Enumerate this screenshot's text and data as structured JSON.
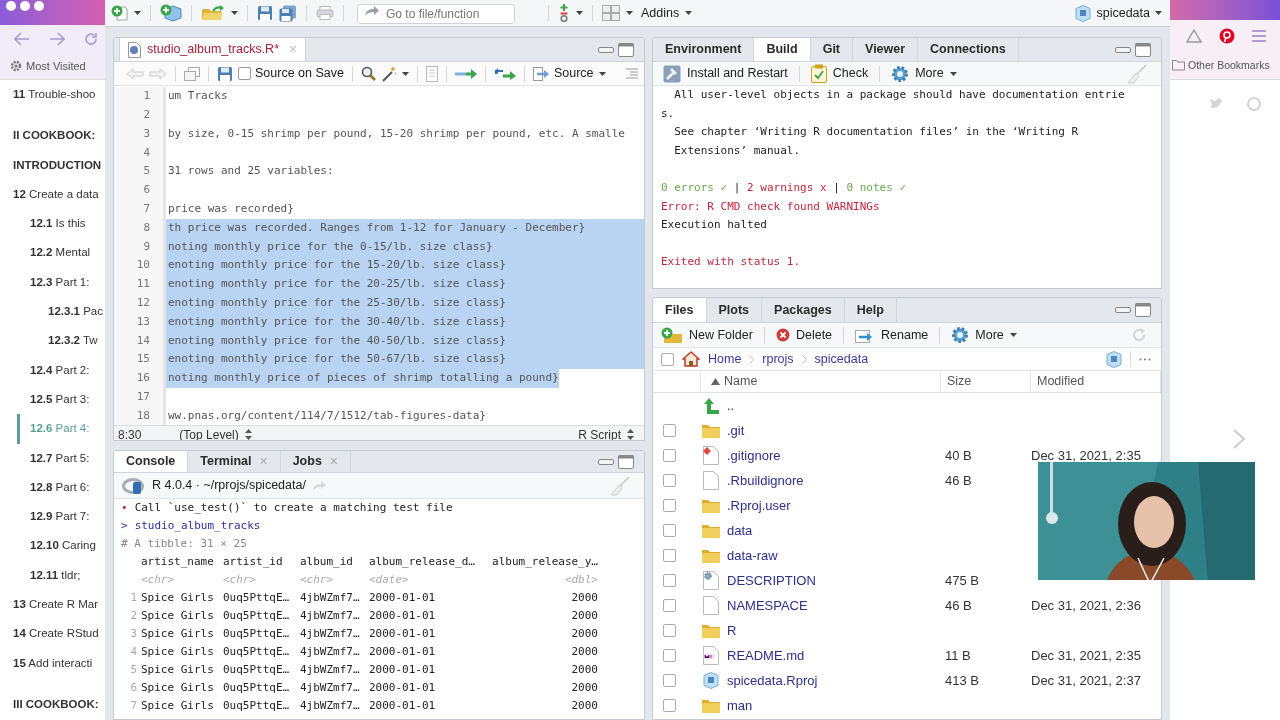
{
  "browser": {
    "bookmark": "Most Visited",
    "other_bookmarks": "Other Bookmarks"
  },
  "toc": [
    {
      "kind": "chapter",
      "text": "**11** Trouble-shoo",
      "selected": false
    },
    {
      "kind": "part",
      "text": "II COOKBOOK:",
      "selected": false
    },
    {
      "kind": "part",
      "text": "INTRODUCTION",
      "selected": false
    },
    {
      "kind": "chapter",
      "text": "**12** Create a data",
      "selected": false,
      "children": [
        {
          "kind": "chapter",
          "text": "**12.1** Is this",
          "selected": false
        },
        {
          "kind": "chapter",
          "text": "**12.2** Mental",
          "selected": false
        },
        {
          "kind": "chapter",
          "text": "**12.3** Part 1:",
          "selected": false,
          "children": [
            {
              "kind": "chapter",
              "text": "**12.3.1** Pac",
              "selected": false
            },
            {
              "kind": "chapter",
              "text": "**12.3.2** Tw",
              "selected": false
            }
          ]
        },
        {
          "kind": "chapter",
          "text": "**12.4** Part 2:",
          "selected": false
        },
        {
          "kind": "chapter",
          "text": "**12.5** Part 3:",
          "selected": false
        },
        {
          "kind": "chapter",
          "text": "**12.6** Part 4:",
          "selected": true
        },
        {
          "kind": "chapter",
          "text": "**12.7** Part 5:",
          "selected": false
        },
        {
          "kind": "chapter",
          "text": "**12.8** Part 6:",
          "selected": false
        },
        {
          "kind": "chapter",
          "text": "**12.9** Part 7:",
          "selected": false
        },
        {
          "kind": "chapter",
          "text": "**12.10** Caring",
          "selected": false
        },
        {
          "kind": "chapter",
          "text": "**12.11** tldr;",
          "selected": false
        }
      ]
    },
    {
      "kind": "chapter",
      "text": "**13** Create R Mar",
      "selected": false
    },
    {
      "kind": "chapter",
      "text": "**14** Create RStud",
      "selected": false
    },
    {
      "kind": "chapter",
      "text": "**15** Add interacti",
      "selected": false
    },
    {
      "kind": "part",
      "text": "III COOKBOOK:",
      "selected": false
    }
  ],
  "toolbar": {
    "goto_placeholder": "Go to file/function",
    "addins": "Addins",
    "project": "spicedata"
  },
  "editor": {
    "tab": {
      "name": "studio_album_tracks.R*",
      "modified": true,
      "close": "×"
    },
    "source_on_save": {
      "label": "Source on Save",
      "checked": false
    },
    "source": "Source",
    "lines": [
      {
        "number": "1",
        "text": "um Tracks",
        "selected": false
      },
      {
        "number": "2",
        "selected": false
      },
      {
        "number": "3",
        "text": "by size, 0-15 shrimp per pound, 15-20 shrimp per pound, etc. A smalle",
        "selected": false
      },
      {
        "number": "4",
        "selected": false
      },
      {
        "number": "5",
        "text": "31 rows and 25 variables:",
        "selected": false
      },
      {
        "number": "6",
        "selected": false
      },
      {
        "number": "7",
        "text": "price was recorded}",
        "selected": false
      },
      {
        "number": "8",
        "text": "th price was recorded. Ranges from 1-12 for January - December}",
        "selected": true
      },
      {
        "number": "9",
        "text": "noting monthly price for the 0-15/lb. size class}",
        "selected": true
      },
      {
        "number": "10",
        "text": "enoting monthly price for the 15-20/lb. size class}",
        "selected": true
      },
      {
        "number": "11",
        "text": "enoting monthly price for the 20-25/lb. size class}",
        "selected": true
      },
      {
        "number": "12",
        "text": "enoting monthly price for the 25-30/lb. size class}",
        "selected": true
      },
      {
        "number": "13",
        "text": "enoting monthly price for the 30-40/lb. size class}",
        "selected": true
      },
      {
        "number": "14",
        "text": "enoting monthly price for the 40-50/lb. size class}",
        "selected": true
      },
      {
        "number": "15",
        "text": "enoting monthly price for the 50-67/lb. size class}",
        "selected": true
      },
      {
        "number": "16",
        "text": "noting monthly price of pieces of shrimp totalling a pound}",
        "selected": true
      },
      {
        "number": "17",
        "selected": false
      },
      {
        "number": "18",
        "text": "ww.pnas.org/content/114/7/1512/tab-figures-data}",
        "selected": false
      }
    ],
    "position": "8:30",
    "scope": "(Top Level)",
    "file_type": "R Script"
  },
  "console": {
    "tabs": [
      {
        "label": "Console",
        "selected": true
      },
      {
        "label": "Terminal",
        "selected": false,
        "close": "×"
      },
      {
        "label": "Jobs",
        "selected": false,
        "close": "×"
      }
    ],
    "header": "R 4.0.4 · ~/rprojs/spicedata/",
    "lines": [
      {
        "kind": "message",
        "bullet": "•",
        "text": "Call `use_test()` to create a matching test file"
      },
      {
        "kind": "input",
        "prompt": ">",
        "text": "studio_album_tracks"
      },
      {
        "kind": "comment",
        "text": "# A tibble: 31 × 25"
      }
    ],
    "table": {
      "columns": [
        {
          "name": "artist_name",
          "type": "<chr>"
        },
        {
          "name": "artist_id",
          "type": "<chr>"
        },
        {
          "name": "album_id",
          "type": "<chr>"
        },
        {
          "name": "album_release_d…",
          "type": "<date>"
        },
        {
          "name": "album_release_y…",
          "type": "<dbl>"
        }
      ],
      "rows": [
        {
          "index": "1",
          "cells": [
            "Spice Girls",
            "0uq5PttqE…",
            "4jbWZmf7…",
            "2000-01-01",
            "2000"
          ]
        },
        {
          "index": "2",
          "cells": [
            "Spice Girls",
            "0uq5PttqE…",
            "4jbWZmf7…",
            "2000-01-01",
            "2000"
          ]
        },
        {
          "index": "3",
          "cells": [
            "Spice Girls",
            "0uq5PttqE…",
            "4jbWZmf7…",
            "2000-01-01",
            "2000"
          ]
        },
        {
          "index": "4",
          "cells": [
            "Spice Girls",
            "0uq5PttqE…",
            "4jbWZmf7…",
            "2000-01-01",
            "2000"
          ]
        },
        {
          "index": "5",
          "cells": [
            "Spice Girls",
            "0uq5PttqE…",
            "4jbWZmf7…",
            "2000-01-01",
            "2000"
          ]
        },
        {
          "index": "6",
          "cells": [
            "Spice Girls",
            "0uq5PttqE…",
            "4jbWZmf7…",
            "2000-01-01",
            "2000"
          ]
        },
        {
          "index": "7",
          "cells": [
            "Spice Girls",
            "0uq5PttqE…",
            "4jbWZmf7…",
            "2000-01-01",
            "2000"
          ]
        }
      ]
    }
  },
  "build": {
    "tabs": [
      {
        "label": "Environment",
        "selected": false
      },
      {
        "label": "Build",
        "selected": true
      },
      {
        "label": "Git",
        "selected": false
      },
      {
        "label": "Viewer",
        "selected": false
      },
      {
        "label": "Connections",
        "selected": false
      }
    ],
    "actions": [
      {
        "kind": "install",
        "label": "Install and Restart"
      },
      {
        "kind": "check",
        "label": "Check"
      },
      {
        "kind": "more",
        "label": "More"
      }
    ],
    "output": [
      {
        "segments": [
          {
            "kind": "plain",
            "text": "  All user-level objects in a package should have documentation entrie"
          }
        ]
      },
      {
        "segments": [
          {
            "kind": "plain",
            "text": "s."
          }
        ]
      },
      {
        "segments": [
          {
            "kind": "plain",
            "text": "  See chapter ‘Writing R documentation files’ in the ‘Writing R"
          }
        ]
      },
      {
        "segments": [
          {
            "kind": "plain",
            "text": "  Extensions’ manual."
          }
        ]
      },
      {
        "kind": "blank"
      },
      {
        "segments": [
          {
            "kind": "ok",
            "text": "0 errors ✓"
          },
          {
            "kind": "plain",
            "text": " | "
          },
          {
            "kind": "error",
            "text": "2 warnings x"
          },
          {
            "kind": "plain",
            "text": " | "
          },
          {
            "kind": "ok",
            "text": "0 notes ✓"
          }
        ]
      },
      {
        "segments": [
          {
            "kind": "error",
            "text": "Error: R CMD check found WARNINGs"
          }
        ]
      },
      {
        "segments": [
          {
            "kind": "plain",
            "text": "Execution halted"
          }
        ]
      },
      {
        "kind": "blank"
      },
      {
        "segments": [
          {
            "kind": "error",
            "text": "Exited with status 1."
          }
        ]
      }
    ]
  },
  "files": {
    "tabs": [
      {
        "label": "Files",
        "selected": true
      },
      {
        "label": "Plots",
        "selected": false
      },
      {
        "label": "Packages",
        "selected": false
      },
      {
        "label": "Help",
        "selected": false
      }
    ],
    "actions": [
      {
        "kind": "new_folder",
        "label": "New Folder"
      },
      {
        "kind": "delete",
        "label": "Delete"
      },
      {
        "kind": "rename",
        "label": "Rename"
      },
      {
        "kind": "more",
        "label": "More"
      }
    ],
    "select_all": {
      "checked": false
    },
    "breadcrumb": [
      "Home",
      "rprojs",
      "spicedata"
    ],
    "columns": [
      "Name",
      "Size",
      "Modified"
    ],
    "rows": [
      {
        "kind": "up",
        "name": ".."
      },
      {
        "kind": "folder",
        "name": ".git",
        "checked": false
      },
      {
        "kind": "git",
        "name": ".gitignore",
        "size": "40 B",
        "modified": "Dec 31, 2021, 2:35",
        "checked": false
      },
      {
        "kind": "file",
        "name": ".Rbuildignore",
        "size": "46 B",
        "checked": false
      },
      {
        "kind": "folder",
        "name": ".Rproj.user",
        "checked": false
      },
      {
        "kind": "folder",
        "name": "data",
        "checked": false
      },
      {
        "kind": "folder",
        "name": "data-raw",
        "checked": false
      },
      {
        "kind": "settings",
        "name": "DESCRIPTION",
        "size": "475 B",
        "checked": false
      },
      {
        "kind": "file",
        "name": "NAMESPACE",
        "size": "46 B",
        "modified": "Dec 31, 2021, 2:36",
        "checked": false
      },
      {
        "kind": "folder",
        "name": "R",
        "checked": false
      },
      {
        "kind": "markdown",
        "name": "README.md",
        "size": "11 B",
        "modified": "Dec 31, 2021, 2:35",
        "checked": false
      },
      {
        "kind": "rproj",
        "name": "spicedata.Rproj",
        "size": "413 B",
        "modified": "Dec 31, 2021, 2:37",
        "checked": false
      },
      {
        "kind": "folder",
        "name": "man",
        "checked": false
      }
    ]
  }
}
